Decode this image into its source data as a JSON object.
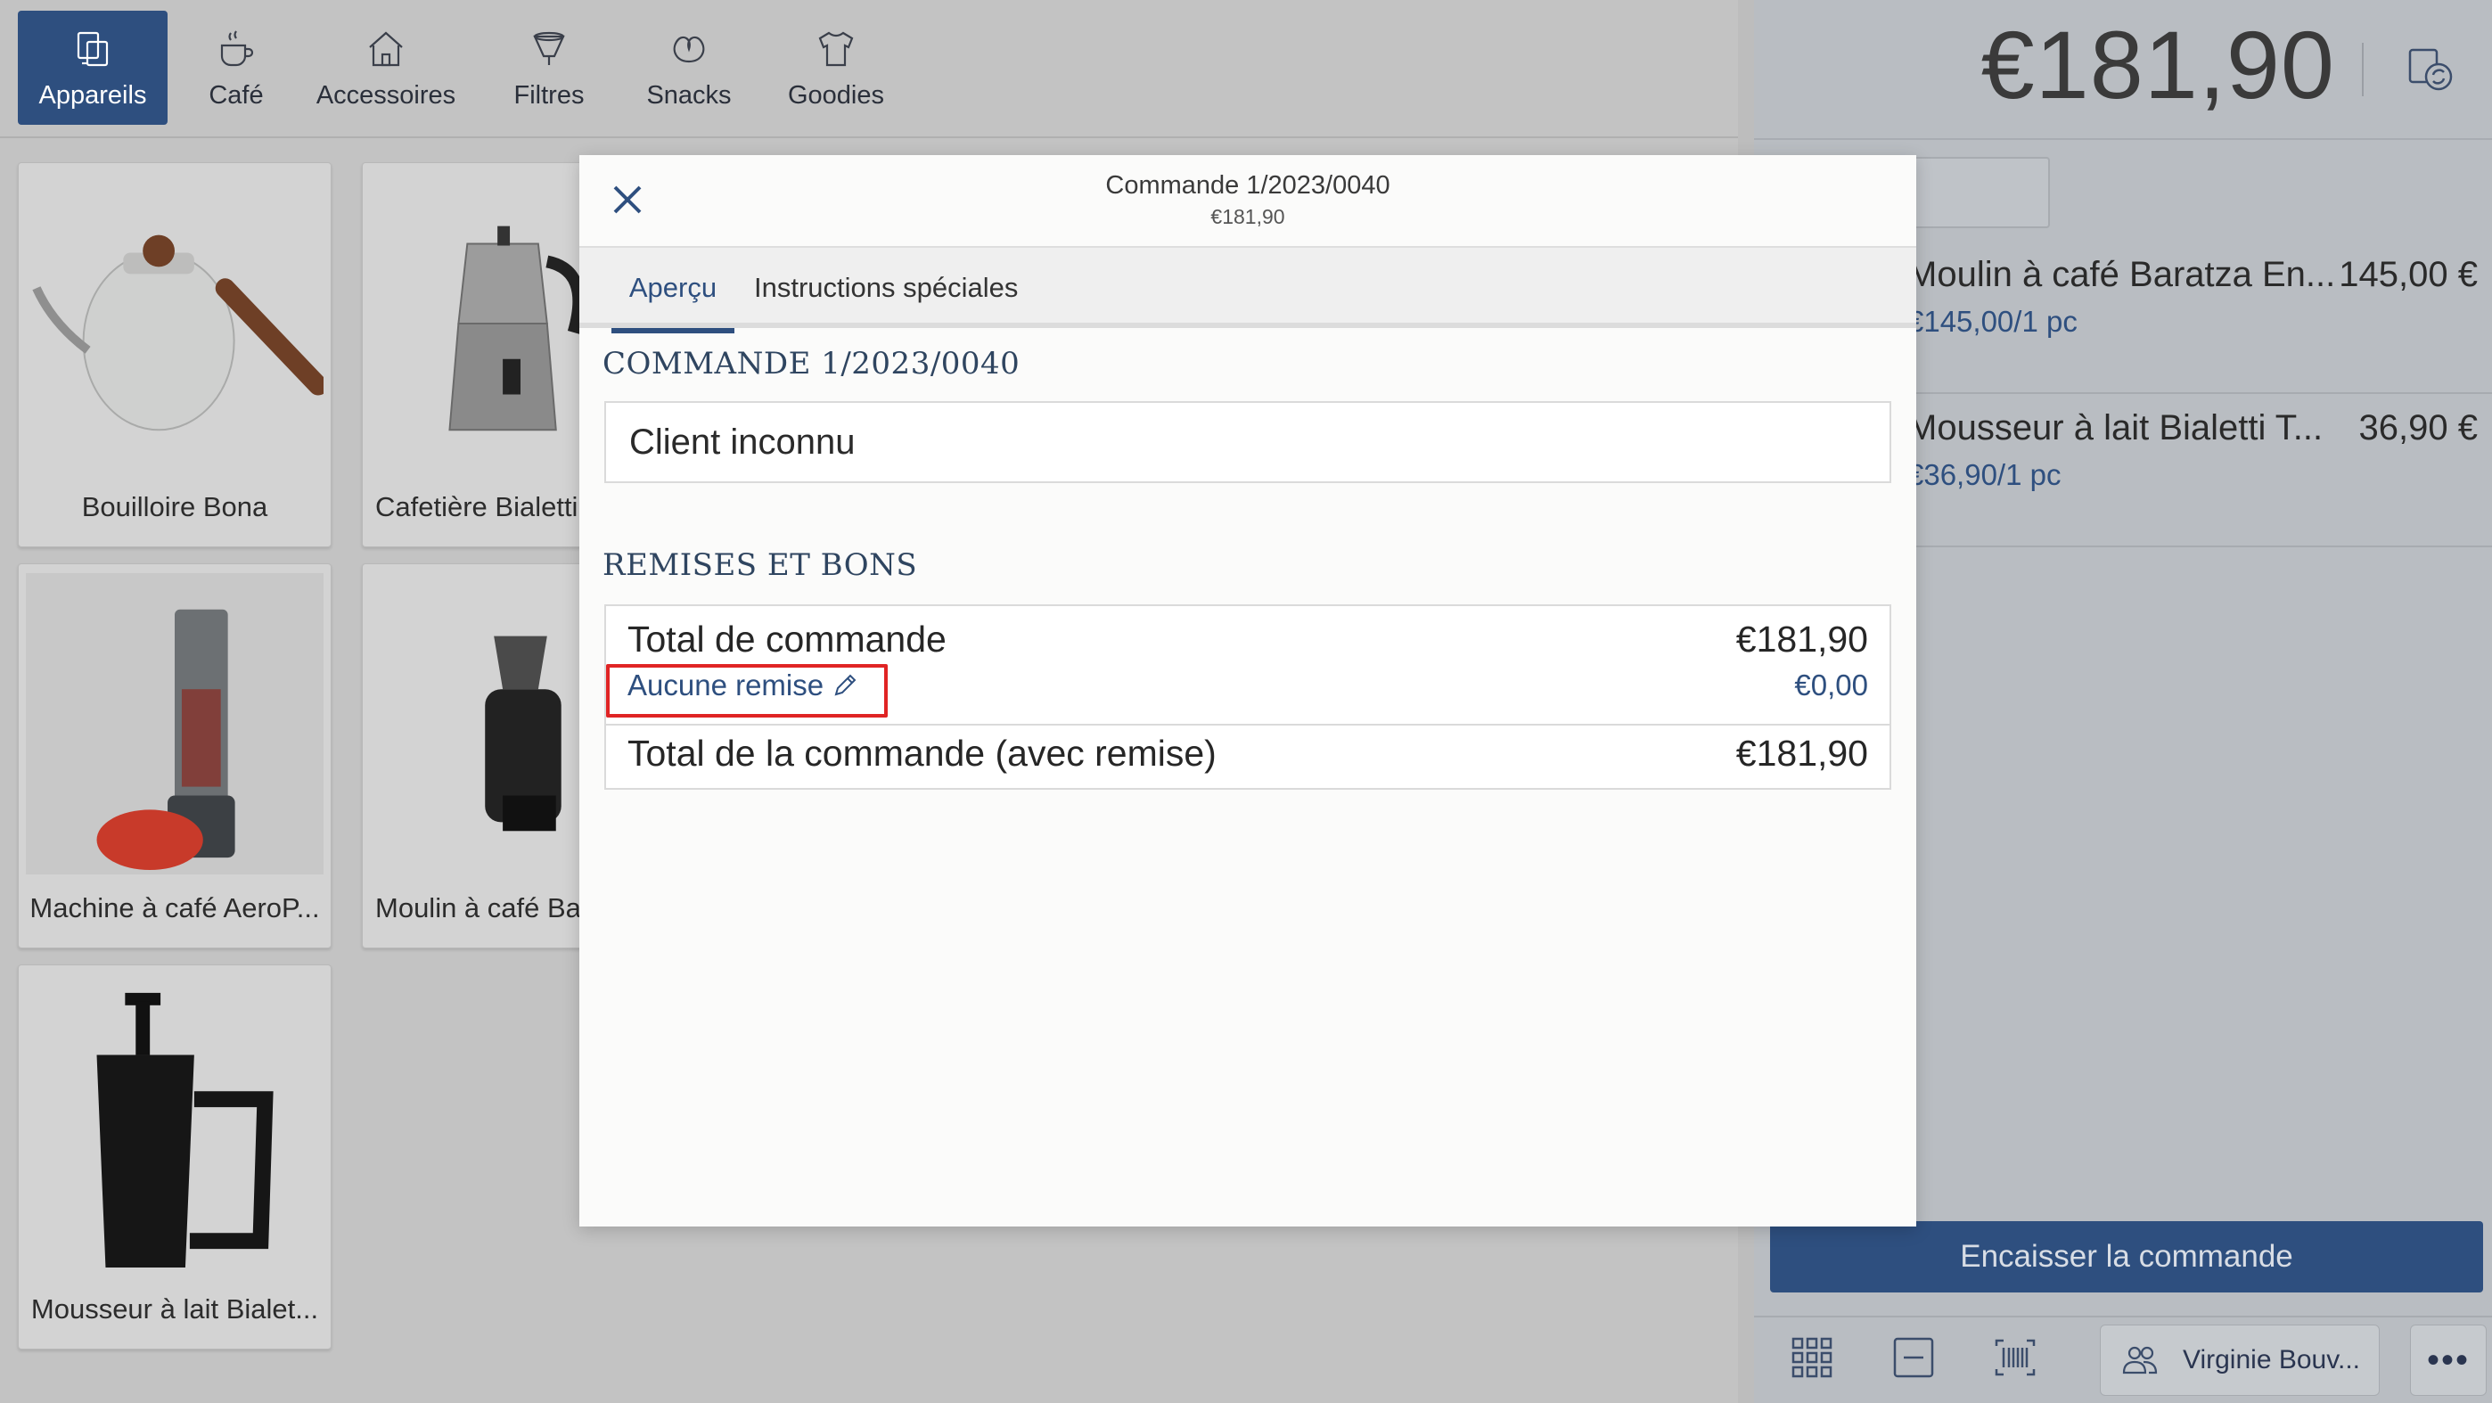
{
  "categories": [
    {
      "label": "Appareils",
      "icon": "devices-icon",
      "active": true
    },
    {
      "label": "Café",
      "icon": "coffee-cup-icon",
      "active": false
    },
    {
      "label": "Accessoires",
      "icon": "house-icon",
      "active": false
    },
    {
      "label": "Filtres",
      "icon": "filter-cone-icon",
      "active": false
    },
    {
      "label": "Snacks",
      "icon": "pretzel-icon",
      "active": false
    },
    {
      "label": "Goodies",
      "icon": "tshirt-icon",
      "active": false
    }
  ],
  "products": [
    {
      "label": "Bouilloire Bona",
      "icon": "kettle-image"
    },
    {
      "label": "Cafetière Bialetti",
      "icon": "moka-pot-image"
    },
    {
      "label": "Machine à café AeroP...",
      "icon": "aeropress-image"
    },
    {
      "label": "Moulin à café Bar",
      "icon": "grinder-image"
    },
    {
      "label": "Mousseur à lait Bialet...",
      "icon": "milk-frother-image"
    }
  ],
  "cart": {
    "total": "€181,90",
    "lines": [
      {
        "name": "Moulin à café Baratza En...",
        "price": "145,00 €",
        "unit": "€145,00/1 pc"
      },
      {
        "name": "Mousseur à lait Bialetti T...",
        "price": "36,90 €",
        "unit": "€36,90/1 pc"
      }
    ],
    "checkout_label": "Encaisser la commande",
    "user_label": "Virginie Bouv...",
    "more_label": "•••"
  },
  "modal": {
    "title": "Commande 1/2023/0040",
    "subtitle": "€181,90",
    "tabs": [
      "Aperçu",
      "Instructions spéciales"
    ],
    "order_heading": "COMMANDE 1/2023/0040",
    "client": "Client inconnu",
    "discounts_heading": "REMISES ET BONS",
    "order_total_label": "Total de commande",
    "order_total_value": "€181,90",
    "discount_link": "Aucune remise",
    "discount_value": "€0,00",
    "discounted_total_label": "Total de la commande (avec remise)",
    "discounted_total_value": "€181,90"
  },
  "colors": {
    "accent": "#2e4f7f",
    "highlight": "#e02424"
  }
}
